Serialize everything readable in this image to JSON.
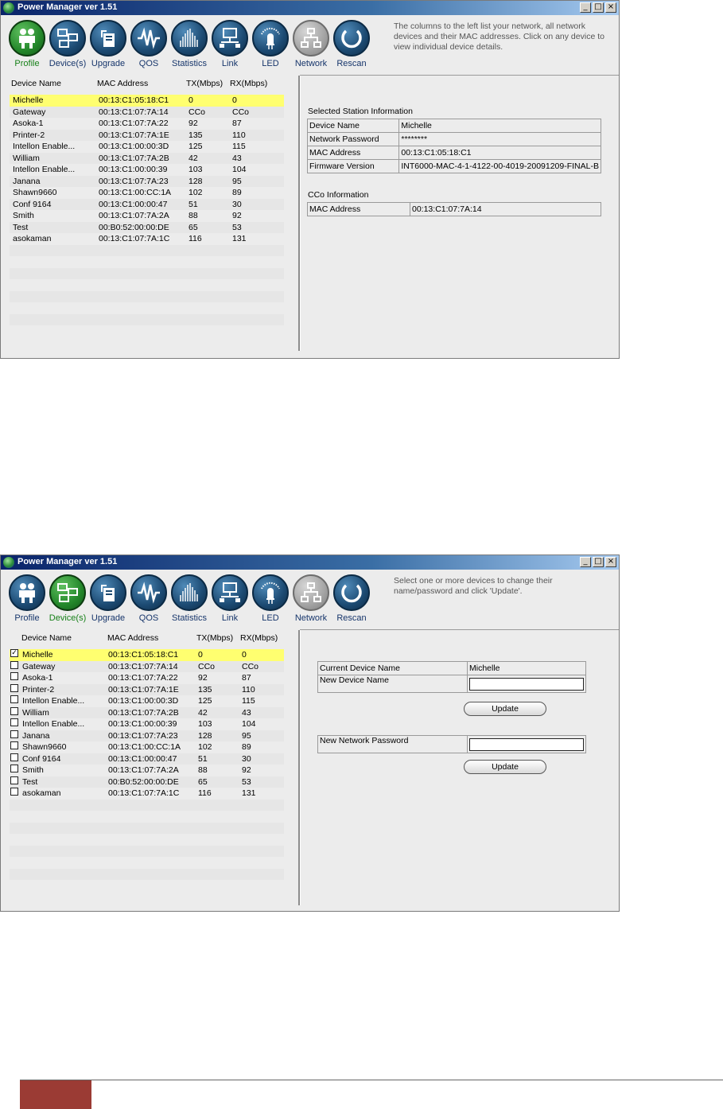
{
  "window": {
    "title": "Power Manager ver 1.51",
    "controls": {
      "minimize": "_",
      "maximize": "□",
      "close": "×"
    }
  },
  "toolbar": {
    "items": [
      {
        "label": "Profile",
        "icon": "profile-icon"
      },
      {
        "label": "Device(s)",
        "icon": "devices-icon"
      },
      {
        "label": "Upgrade",
        "icon": "upgrade-icon"
      },
      {
        "label": "QOS",
        "icon": "qos-icon"
      },
      {
        "label": "Statistics",
        "icon": "statistics-icon"
      },
      {
        "label": "Link",
        "icon": "link-icon"
      },
      {
        "label": "LED",
        "icon": "led-icon"
      },
      {
        "label": "Network",
        "icon": "network-icon"
      },
      {
        "label": "Rescan",
        "icon": "rescan-icon"
      }
    ]
  },
  "list": {
    "headers": {
      "name": "Device Name",
      "mac": "MAC Address",
      "tx": "TX(Mbps)",
      "rx": "RX(Mbps)"
    },
    "devices": [
      {
        "name": "Michelle",
        "mac": "00:13:C1:05:18:C1",
        "tx": "0",
        "rx": "0"
      },
      {
        "name": "Gateway",
        "mac": "00:13:C1:07:7A:14",
        "tx": "CCo",
        "rx": "CCo"
      },
      {
        "name": "Asoka-1",
        "mac": "00:13:C1:07:7A:22",
        "tx": "92",
        "rx": "87"
      },
      {
        "name": "Printer-2",
        "mac": "00:13:C1:07:7A:1E",
        "tx": "135",
        "rx": "110"
      },
      {
        "name": "Intellon Enable...",
        "mac": "00:13:C1:00:00:3D",
        "tx": "125",
        "rx": "115"
      },
      {
        "name": "William",
        "mac": "00:13:C1:07:7A:2B",
        "tx": "42",
        "rx": "43"
      },
      {
        "name": "Intellon Enable...",
        "mac": "00:13:C1:00:00:39",
        "tx": "103",
        "rx": "104"
      },
      {
        "name": "Janana",
        "mac": "00:13:C1:07:7A:23",
        "tx": "128",
        "rx": "95"
      },
      {
        "name": "Shawn9660",
        "mac": "00:13:C1:00:CC:1A",
        "tx": "102",
        "rx": "89"
      },
      {
        "name": "Conf 9164",
        "mac": "00:13:C1:00:00:47",
        "tx": "51",
        "rx": "30"
      },
      {
        "name": "Smith",
        "mac": "00:13:C1:07:7A:2A",
        "tx": "88",
        "rx": "92"
      },
      {
        "name": "Test",
        "mac": "00:B0:52:00:00:DE",
        "tx": "65",
        "rx": "53"
      },
      {
        "name": "asokaman",
        "mac": "00:13:C1:07:7A:1C",
        "tx": "116",
        "rx": "131"
      }
    ]
  },
  "screen1": {
    "hint": "The columns to the left list your network, all network devices and their MAC addresses. Click on any device to view individual device details.",
    "station_title": "Selected Station Information",
    "station_rows": [
      {
        "label": "Device Name",
        "value": "Michelle"
      },
      {
        "label": "Network Password",
        "value": "********"
      },
      {
        "label": "MAC Address",
        "value": "00:13:C1:05:18:C1"
      },
      {
        "label": "Firmware Version",
        "value": "INT6000-MAC-4-1-4122-00-4019-20091209-FINAL-B"
      }
    ],
    "cco_title": "CCo Information",
    "cco_rows": [
      {
        "label": "MAC Address",
        "value": "00:13:C1:07:7A:14"
      }
    ]
  },
  "screen2": {
    "hint": "Select one or more devices to change their name/password and click 'Update'.",
    "checked_mark": "✓",
    "current_name_label": "Current Device Name",
    "current_name_value": "Michelle",
    "new_name_label": "New Device Name",
    "new_password_label": "New Network Password",
    "update_label": "Update"
  }
}
